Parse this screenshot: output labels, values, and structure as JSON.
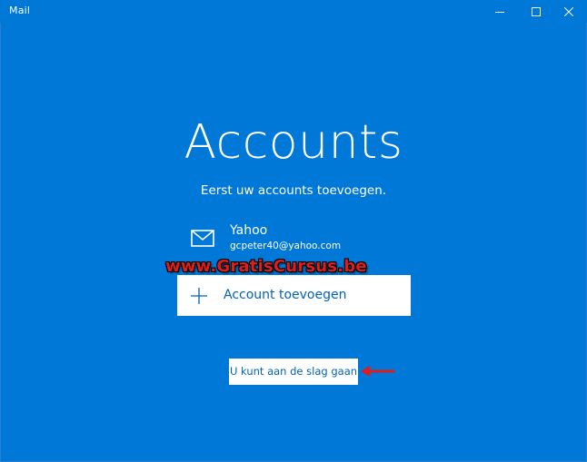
{
  "window": {
    "title": "Mail",
    "controls": {
      "minimize_icon": "minimize-icon",
      "maximize_icon": "maximize-icon",
      "close_icon": "close-icon"
    }
  },
  "main": {
    "title": "Accounts",
    "subtitle": "Eerst uw accounts toevoegen.",
    "accounts": [
      {
        "icon": "mail-icon",
        "name": "Yahoo",
        "email": "gcpeter40@yahoo.com"
      }
    ],
    "add_account": {
      "icon": "plus-icon",
      "label": "Account toevoegen"
    },
    "get_started": {
      "label": "U kunt aan de slag gaan"
    }
  },
  "overlay": {
    "watermark": "www.GratisCursus.be",
    "annotation_arrow_color": "#e11c1c"
  },
  "colors": {
    "background": "#0078d7",
    "accent_text": "#0063b1",
    "button_bg": "#ffffff"
  }
}
